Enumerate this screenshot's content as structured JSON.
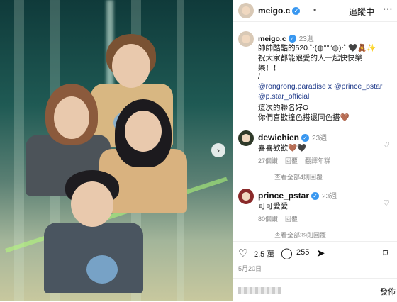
{
  "post": {
    "image_alt": "",
    "next_arrow": "›"
  },
  "header": {
    "username": "meigo.c",
    "separator": "•",
    "follow_label": "追蹤中",
    "more_icon": "ellipsis-icon"
  },
  "caption": {
    "username": "meigo.c",
    "age": "23週",
    "lines": [
      "帥帥酷酷的520.˚‧(◍ᐡᐤᐡ◍)‧˚.🖤🧸✨",
      "祝大家都能跟愛的人一起快快樂",
      "樂！！",
      "/",
      "@rongrong.paradise x @prince_pstar",
      "@p.star_official",
      "這次的聯名好Q",
      "你們喜歡撞色搭還同色搭🤎"
    ]
  },
  "comments": [
    {
      "username": "dewichien",
      "age": "23週",
      "text": "喜喜歡歡🤎🖤",
      "likes": "27個讚",
      "reply": "回覆",
      "translate": "翻譯年糕",
      "view_replies": "查看全部4則回覆"
    },
    {
      "username": "prince_pstar",
      "age": "23週",
      "text": "可可愛愛",
      "likes": "80個讚",
      "reply": "回覆",
      "view_replies": "查看全部39則回覆"
    }
  ],
  "actions": {
    "like_count": "2.5 萬",
    "comment_count": "255",
    "like_icon": "heart-icon",
    "comment_icon": "comment-icon",
    "share_icon": "send-icon",
    "save_icon": "bookmark-icon"
  },
  "date": "5月20日",
  "compose": {
    "post_label": "發佈"
  }
}
